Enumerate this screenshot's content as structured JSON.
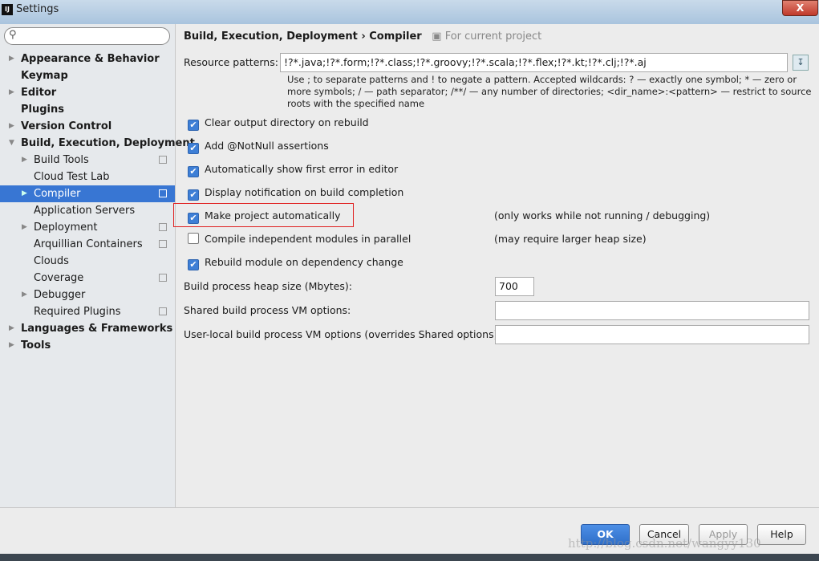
{
  "window": {
    "title": "Settings",
    "close": "X",
    "logo": "IJ"
  },
  "search": {
    "placeholder": "",
    "icon": "search-icon"
  },
  "sidebar": {
    "items": [
      {
        "label": "Appearance & Behavior",
        "bold": true,
        "arrow": "right",
        "level": 0
      },
      {
        "label": "Keymap",
        "bold": true,
        "level": 0
      },
      {
        "label": "Editor",
        "bold": true,
        "arrow": "right",
        "level": 0
      },
      {
        "label": "Plugins",
        "bold": true,
        "level": 0
      },
      {
        "label": "Version Control",
        "bold": true,
        "arrow": "right",
        "level": 0
      },
      {
        "label": "Build, Execution, Deployment",
        "bold": true,
        "arrow": "down",
        "level": 0
      },
      {
        "label": "Build Tools",
        "arrow": "right",
        "level": 1,
        "project": true
      },
      {
        "label": "Cloud Test Lab",
        "level": 1
      },
      {
        "label": "Compiler",
        "arrow": "right",
        "level": 1,
        "project": true,
        "selected": true
      },
      {
        "label": "Application Servers",
        "level": 1
      },
      {
        "label": "Deployment",
        "arrow": "right",
        "level": 1,
        "project": true
      },
      {
        "label": "Arquillian Containers",
        "level": 1,
        "project": true
      },
      {
        "label": "Clouds",
        "level": 1
      },
      {
        "label": "Coverage",
        "level": 1,
        "project": true
      },
      {
        "label": "Debugger",
        "arrow": "right",
        "level": 1
      },
      {
        "label": "Required Plugins",
        "level": 1,
        "project": true
      },
      {
        "label": "Languages & Frameworks",
        "bold": true,
        "arrow": "right",
        "level": 0
      },
      {
        "label": "Tools",
        "bold": true,
        "arrow": "right",
        "level": 0
      }
    ]
  },
  "main": {
    "breadcrumb": {
      "parent": "Build, Execution, Deployment",
      "sep": "›",
      "current": "Compiler",
      "scope": "For current project"
    },
    "resource_patterns": {
      "label": "Resource patterns:",
      "value": "!?*.java;!?*.form;!?*.class;!?*.groovy;!?*.scala;!?*.flex;!?*.kt;!?*.clj;!?*.aj",
      "hint": "Use ; to separate patterns and ! to negate a pattern. Accepted wildcards: ? — exactly one symbol; * — zero or more symbols; / — path separator; /**/ — any number of directories; <dir_name>:<pattern> — restrict to source roots with the specified name"
    },
    "checkboxes": [
      {
        "label": "Clear output directory on rebuild",
        "checked": true
      },
      {
        "label": "Add @NotNull assertions",
        "checked": true
      },
      {
        "label": "Automatically show first error in editor",
        "checked": true
      },
      {
        "label": "Display notification on build completion",
        "checked": true
      },
      {
        "label": "Make project automatically",
        "checked": true,
        "note": "(only works while not running / debugging)",
        "highlighted": true
      },
      {
        "label": "Compile independent modules in parallel",
        "checked": false,
        "note": "(may require larger heap size)"
      },
      {
        "label": "Rebuild module on dependency change",
        "checked": true
      }
    ],
    "heap": {
      "label": "Build process heap size (Mbytes):",
      "value": "700"
    },
    "shared_vm": {
      "label": "Shared build process VM options:",
      "value": ""
    },
    "local_vm": {
      "label": "User-local build process VM options (overrides Shared options):",
      "value": ""
    }
  },
  "buttons": {
    "ok": "OK",
    "cancel": "Cancel",
    "apply": "Apply",
    "help": "Help"
  },
  "watermark": "http://blog.csdn.net/wangyy130",
  "colors": {
    "selection": "#3876d3",
    "highlight_box": "#e02020",
    "checkbox": "#3e7fd6"
  }
}
